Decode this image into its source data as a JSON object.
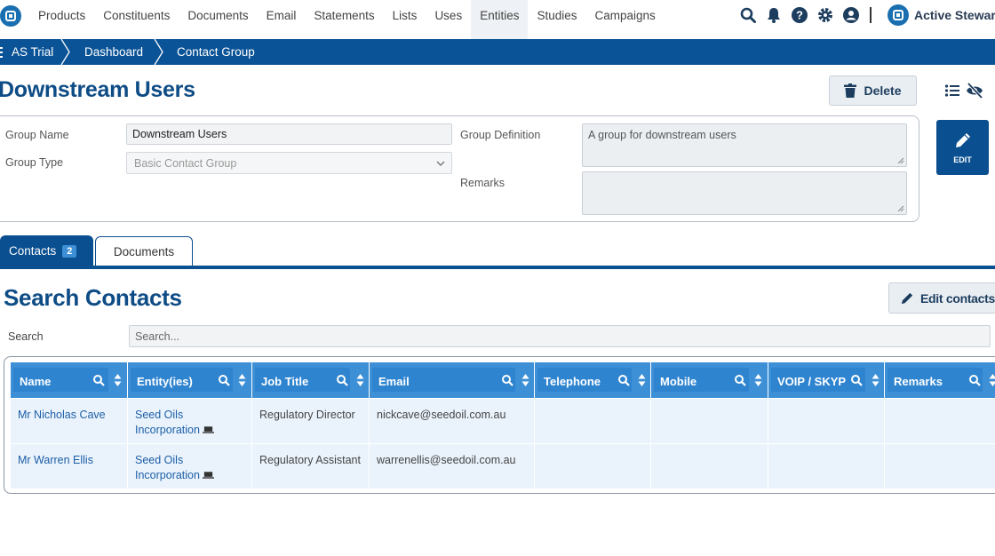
{
  "nav": {
    "items": [
      "Products",
      "Constituents",
      "Documents",
      "Email",
      "Statements",
      "Lists",
      "Uses",
      "Entities",
      "Studies",
      "Campaigns"
    ],
    "active": "Entities",
    "brand": "Active Stewar",
    "icons": [
      "search-icon",
      "bell-icon",
      "help-icon",
      "gear-icon",
      "user-icon"
    ]
  },
  "breadcrumb": [
    "AS Trial",
    "Dashboard",
    "Contact Group"
  ],
  "page": {
    "title": "Downstream Users",
    "delete_label": "Delete",
    "edit_label": "EDIT"
  },
  "form": {
    "group_name_label": "Group Name",
    "group_name_value": "Downstream Users",
    "group_type_label": "Group Type",
    "group_type_value": "Basic Contact Group",
    "group_definition_label": "Group Definition",
    "group_definition_value": "A group for downstream users",
    "remarks_label": "Remarks",
    "remarks_value": ""
  },
  "tabs": {
    "contacts_label": "Contacts",
    "contacts_count": "2",
    "documents_label": "Documents"
  },
  "contacts": {
    "title": "Search Contacts",
    "edit_contacts_label": "Edit contacts",
    "search_label": "Search",
    "search_placeholder": "Search...",
    "columns": [
      "Name",
      "Entity(ies)",
      "Job Title",
      "Email",
      "Telephone",
      "Mobile",
      "VOIP / SKYPE",
      "Remarks"
    ],
    "rows": [
      {
        "name": "Mr Nicholas Cave",
        "entity_line1": "Seed Oils",
        "entity_line2": "Incorporation",
        "job_title": "Regulatory Director",
        "email": "nickcave@seedoil.com.au",
        "telephone": "",
        "mobile": "",
        "voip": "",
        "remarks": ""
      },
      {
        "name": "Mr Warren Ellis",
        "entity_line1": "Seed Oils",
        "entity_line2": "Incorporation",
        "job_title": "Regulatory Assistant",
        "email": "warrenellis@seedoil.com.au",
        "telephone": "",
        "mobile": "",
        "voip": "",
        "remarks": ""
      }
    ]
  },
  "colors": {
    "primary": "#0a5396",
    "header_cell": "#3d8fd6",
    "row_bg": "#eaf3fc",
    "title": "#0e4c86"
  }
}
